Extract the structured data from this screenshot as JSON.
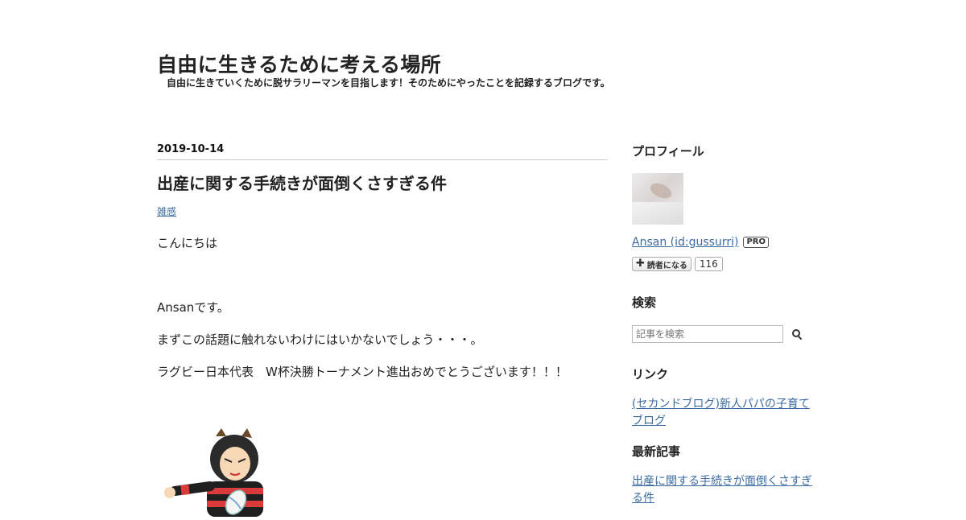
{
  "header": {
    "title": "自由に生きるために考える場所",
    "description": "自由に生きていくために脱サラリーマンを目指します！そのためにやったことを記録するブログです。"
  },
  "entry": {
    "date": "2019-10-14",
    "title": "出産に関する手続きが面倒くさすぎる件",
    "category": "雑感",
    "paragraphs": [
      "こんにちは",
      "Ansanです。",
      "まずこの話題に触れないわけにはいかないでしょう・・・。",
      "ラグビー日本代表　W杯決勝トーナメント進出おめでとうございます！！！"
    ],
    "illustration_icon": "rugby-player-illustration"
  },
  "sidebar": {
    "profile": {
      "title": "プロフィール",
      "name": "Ansan (id:gussurri)",
      "badge": "PRO",
      "subscribe_label": "読者になる",
      "subscriber_count": "116"
    },
    "search": {
      "title": "検索",
      "placeholder": "記事を検索"
    },
    "links": {
      "title": "リンク",
      "items": [
        "(セカンドブログ)新人パパの子育てブログ"
      ]
    },
    "recent": {
      "title": "最新記事",
      "items": [
        "出産に関する手続きが面倒くさすぎる件"
      ]
    }
  }
}
